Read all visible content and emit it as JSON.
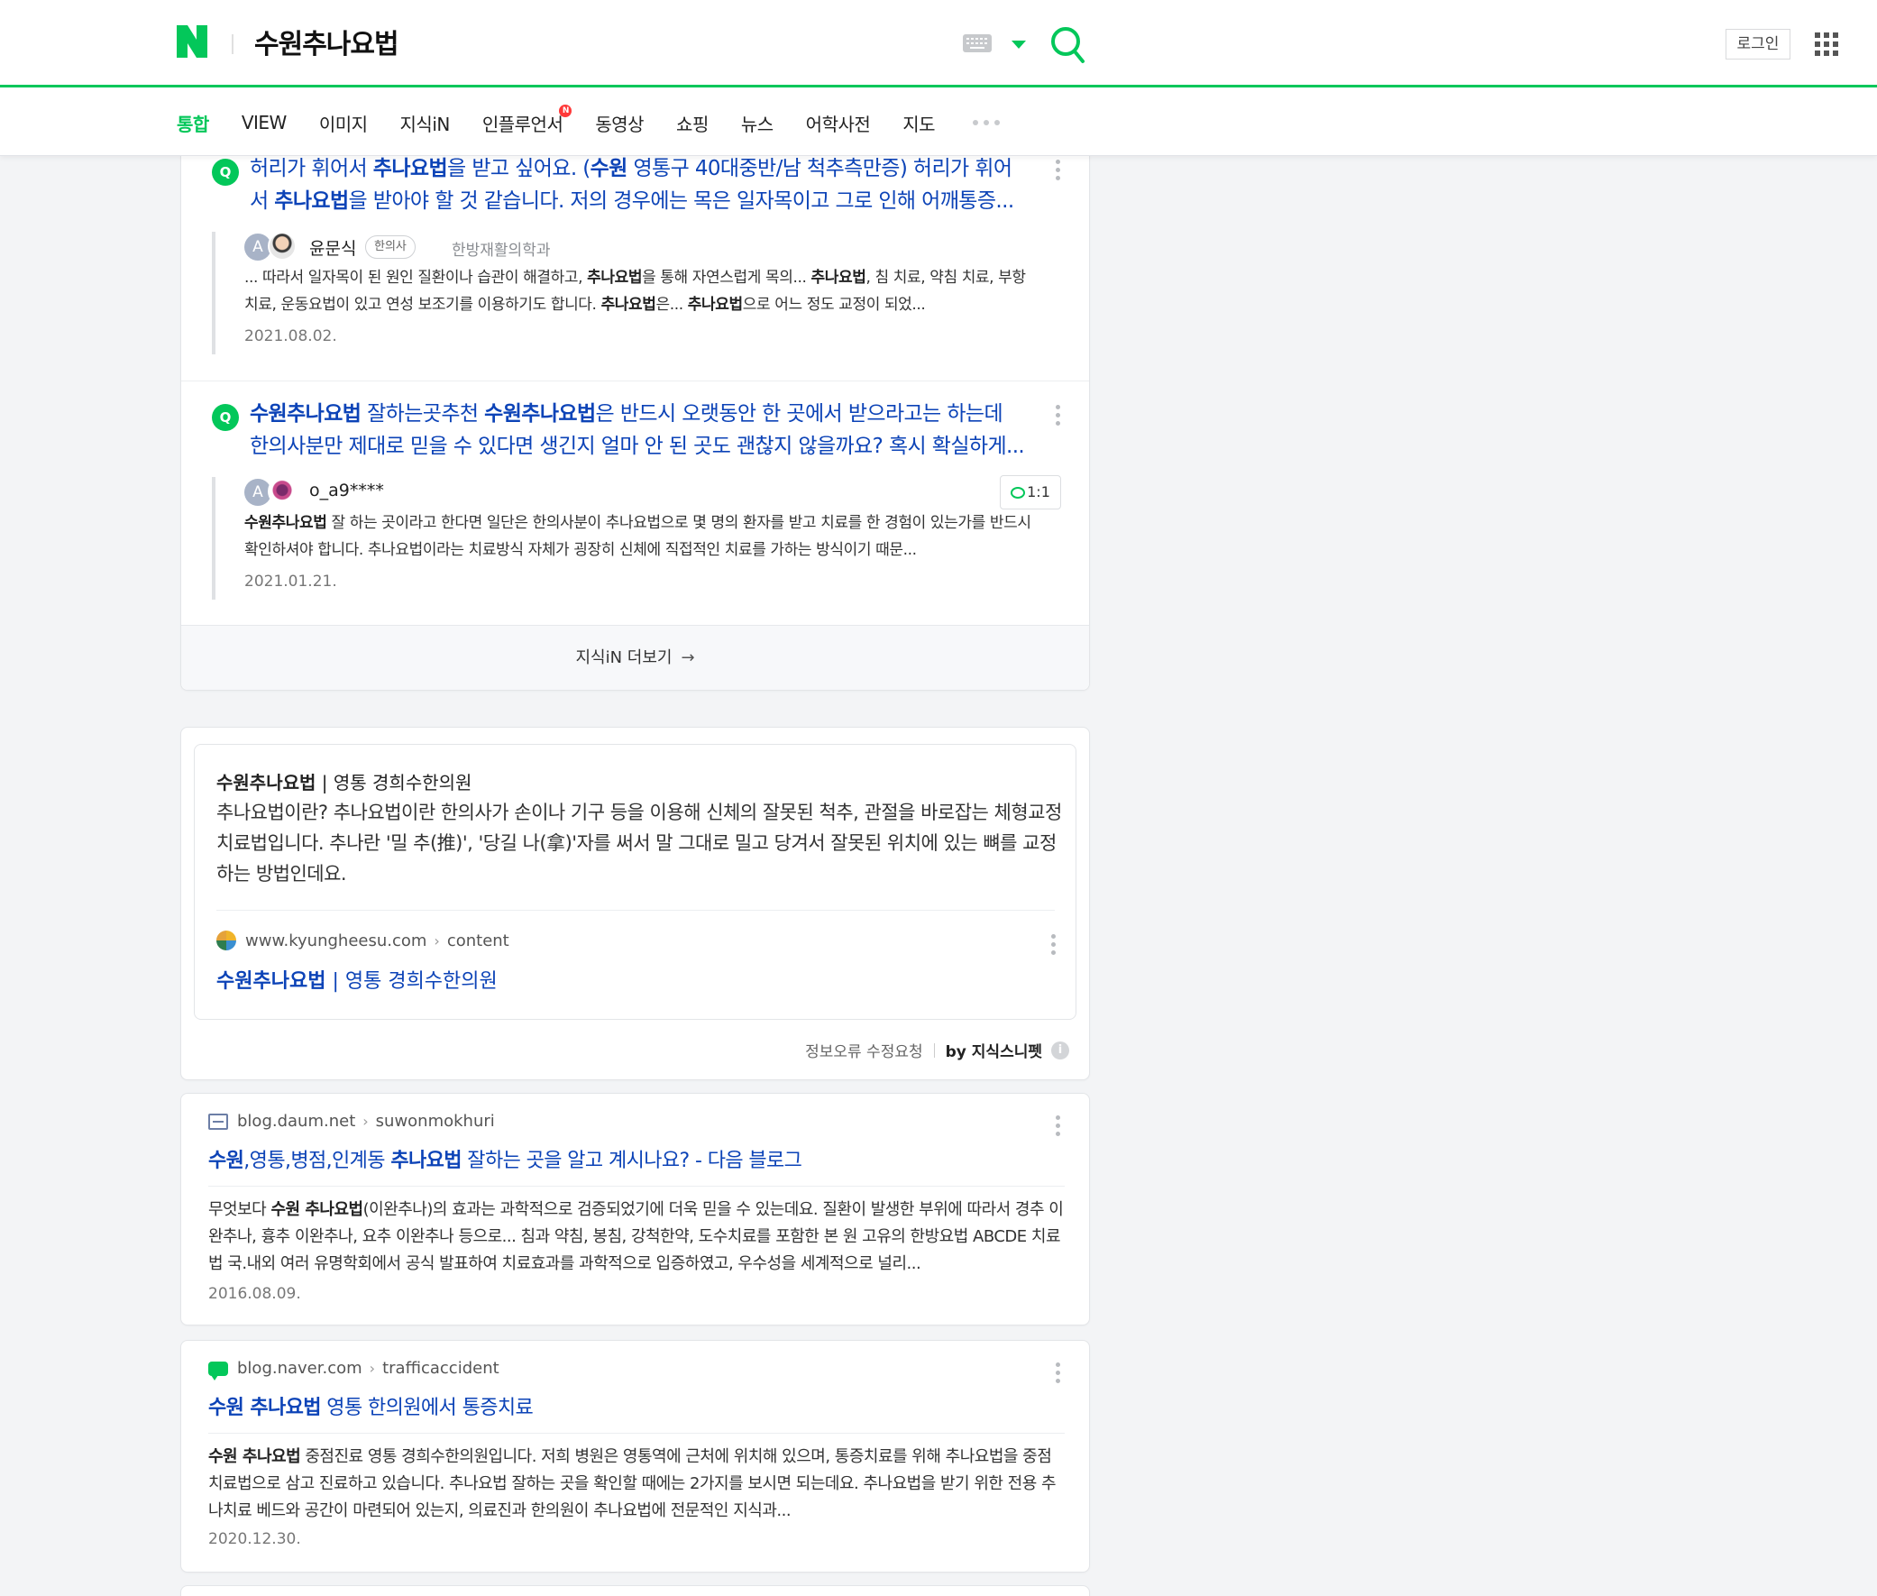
{
  "header": {
    "query": "수원추나요법",
    "login_label": "로그인"
  },
  "tabs": [
    {
      "label": "통합",
      "active": true
    },
    {
      "label": "VIEW"
    },
    {
      "label": "이미지"
    },
    {
      "label": "지식iN"
    },
    {
      "label": "인플루언서",
      "new_badge": "N"
    },
    {
      "label": "동영상"
    },
    {
      "label": "쇼핑"
    },
    {
      "label": "뉴스"
    },
    {
      "label": "어학사전"
    },
    {
      "label": "지도"
    }
  ],
  "kin": {
    "items": [
      {
        "q_icon": "Q",
        "title_parts": [
          "허리가 휘어서 ",
          "추나요법",
          "을 받고 싶어요. (",
          "수원",
          " 영통구 40대중반/남 척추측만증) 허리가 휘어서 ",
          "추나요법",
          "을 받아야 할 것 같습니다. 저의 경우에는 목은 일자목이고 그로 인해 어깨통증..."
        ],
        "avatar_letter": "A",
        "user": "윤문식",
        "badge": "한의사",
        "dept": "한방재활의학과",
        "answer_parts": [
          "... 따라서 일자목이 된 원인 질환이나 습관이 해결하고, ",
          "추나요법",
          "을 통해 자연스럽게 목의... ",
          "추나요법",
          ", 침 치료, 약침 치료, 부항 치료, 운동요법이 있고 연성 보조기를 이용하기도 합니다. ",
          "추나요법",
          "은... ",
          "추나요법",
          "으로 어느 정도 교정이 되었..."
        ],
        "date": "2021.08.02."
      },
      {
        "q_icon": "Q",
        "title_parts": [
          "수원추나요법",
          " 잘하는곳추천 ",
          "수원추나요법",
          "은 반드시 오랫동안 한 곳에서 받으라고는 하는데 한의사분만 제대로 믿을 수 있다면 생긴지 얼마 안 된 곳도 괜찮지 않을까요? 혹시 확실하게..."
        ],
        "avatar_letter": "A",
        "user": "o_a9****",
        "chat_label": "1:1",
        "answer_parts": [
          "수원추나요법",
          " 잘 하는 곳이라고 한다면 일단은 한의사분이 추나요법으로 몇 명의 환자를 받고 치료를 한 경험이 있는가를 반드시 확인하셔야 합니다. 추나요법이라는 치료방식 자체가 굉장히 신체에 직접적인 치료를 가하는 방식이기 때문..."
        ],
        "date": "2021.01.21."
      }
    ],
    "more_label": "지식iN 더보기",
    "more_arrow": "→"
  },
  "snippet": {
    "title_bold": "수원추나요법",
    "title_rest": " | 영통 경희수한의원",
    "body": "추나요법이란? 추나요법이란 한의사가 손이나 기구 등을 이용해 신체의 잘못된 척추, 관절을 바로잡는 체형교정 치료법입니다. 추나란 '밀 추(推)', '당길 나(拿)'자를 써서 말 그대로 밀고 당겨서 잘못된 위치에 있는 뼈를 교정하는 방법인데요.",
    "site": "www.kyungheesu.com",
    "path": "content",
    "link_bold": "수원추나요법",
    "link_rest": " | 영통 경희수한의원",
    "report_label": "정보오류 수정요청",
    "by_label": "by 지식스니펫",
    "info_icon": "i"
  },
  "results": [
    {
      "site": "blog.daum.net",
      "path": "suwonmokhuri",
      "title_parts": [
        "수원",
        ",영통,병점,인계동 ",
        "추나요법",
        " 잘하는 곳을 알고 계시나요? - 다음 블로그"
      ],
      "desc_parts": [
        "무엇보다 ",
        "수원 추나요법",
        "(이완추나)의 효과는 과학적으로 검증되었기에 더욱 믿을 수 있는데요. 질환이 발생한 부위에 따라서 경추 이완추나, 흉추 이완추나, 요추 이완추나 등으로... 침과 약침, 봉침, 강척한약, 도수치료를 포함한 본 원 고유의 한방요법 ABCDE 치료법 국.내외 여러 유명학회에서 공식 발표하여 치료효과를 과학적으로 입증하였고, 우수성을 세계적으로 널리..."
      ],
      "date": "2016.08.09."
    },
    {
      "site": "blog.naver.com",
      "path": "trafficaccident",
      "title_parts": [
        "수원 추나요법",
        " 영통 한의원에서 통증치료"
      ],
      "desc_parts": [
        "수원 추나요법",
        " 중점진료 영통 경희수한의원입니다. 저희 병원은 영통역에 근처에 위치해 있으며, 통증치료를 위해 추나요법을 중점 치료법으로 삼고 진료하고 있습니다. 추나요법 잘하는 곳을 확인할 때에는 2가지를 보시면 되는데요. 추나요법을 받기 위한 전용 추나치료 베드와 공간이 마련되어 있는지, 의료진과 한의원이 추나요법에 전문적인 지식과..."
      ],
      "date": "2020.12.30."
    }
  ],
  "colors": {
    "brand_green": "#03c75a",
    "link_blue": "#0c43b7"
  }
}
